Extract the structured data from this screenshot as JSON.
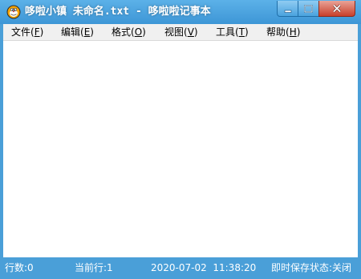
{
  "window": {
    "title": "哆啦小镇 未命名.txt - 哆啦啦记事本",
    "icon": "doraemon-app-icon"
  },
  "controls": {
    "minimize_icon": "minimize-icon",
    "maximize_icon": "maximize-icon",
    "close_icon": "close-icon"
  },
  "menu": [
    {
      "prefix": "文件(",
      "key": "F",
      "suffix": ")"
    },
    {
      "prefix": "编辑(",
      "key": "E",
      "suffix": ")"
    },
    {
      "prefix": "格式(",
      "key": "O",
      "suffix": ")"
    },
    {
      "prefix": "视图(",
      "key": "V",
      "suffix": ")"
    },
    {
      "prefix": "工具(",
      "key": "T",
      "suffix": ")"
    },
    {
      "prefix": "帮助(",
      "key": "H",
      "suffix": ")"
    }
  ],
  "editor": {
    "content": ""
  },
  "status": {
    "line_count": "行数:0",
    "current_line": "当前行:1",
    "datetime": "2020-07-02  11:38:20",
    "autosave": "即时保存状态:关闭"
  },
  "colors": {
    "frame": "#4a9fd8",
    "close_button": "#c8402b",
    "menubar": "#f0f0f0",
    "editor_bg": "#ffffff"
  }
}
